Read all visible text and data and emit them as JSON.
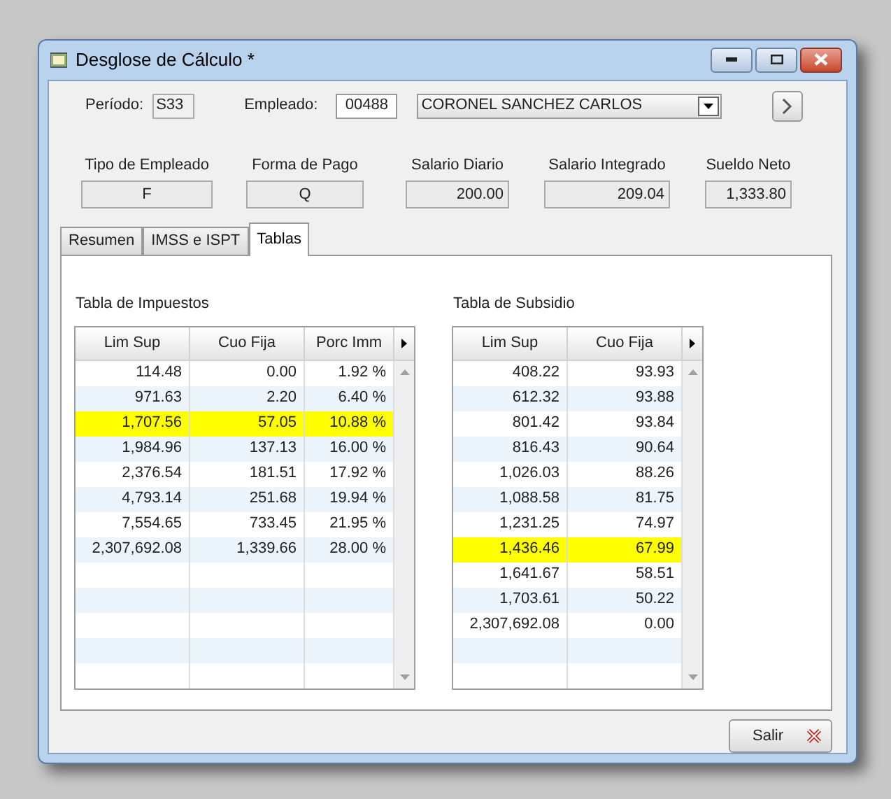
{
  "window": {
    "title": "Desglose de Cálculo *"
  },
  "header": {
    "periodo_label": "Período:",
    "periodo": "S33",
    "empleado_label": "Empleado:",
    "empleado": "00488",
    "nombre": "CORONEL SANCHEZ CARLOS"
  },
  "summary": [
    {
      "label": "Tipo de Empleado",
      "value": "F",
      "kind": "code"
    },
    {
      "label": "Forma de Pago",
      "value": "Q",
      "kind": "code"
    },
    {
      "label": "Salario Diario",
      "value": "200.00",
      "kind": "amount"
    },
    {
      "label": "Salario Integrado",
      "value": "209.04",
      "kind": "amount"
    },
    {
      "label": "Sueldo Neto",
      "value": "1,333.80",
      "kind": "amount"
    }
  ],
  "tabs": [
    {
      "label": "Resumen",
      "selected": false
    },
    {
      "label": "IMSS e ISPT",
      "selected": false
    },
    {
      "label": "Tablas",
      "selected": true
    }
  ],
  "tables": [
    {
      "title": "Tabla de Impuestos",
      "columns": [
        "Lim Sup",
        "Cuo Fija",
        "Porc Imm"
      ],
      "rows": [
        {
          "cells": [
            "114.48",
            "0.00",
            "1.92 %"
          ],
          "selected": false
        },
        {
          "cells": [
            "971.63",
            "2.20",
            "6.40 %"
          ],
          "selected": false
        },
        {
          "cells": [
            "1,707.56",
            "57.05",
            "10.88 %"
          ],
          "selected": true
        },
        {
          "cells": [
            "1,984.96",
            "137.13",
            "16.00 %"
          ],
          "selected": false
        },
        {
          "cells": [
            "2,376.54",
            "181.51",
            "17.92 %"
          ],
          "selected": false
        },
        {
          "cells": [
            "4,793.14",
            "251.68",
            "19.94 %"
          ],
          "selected": false
        },
        {
          "cells": [
            "7,554.65",
            "733.45",
            "21.95 %"
          ],
          "selected": false
        },
        {
          "cells": [
            "2,307,692.08",
            "1,339.66",
            "28.00 %"
          ],
          "selected": false
        }
      ]
    },
    {
      "title": "Tabla de Subsidio",
      "columns": [
        "Lim Sup",
        "Cuo Fija"
      ],
      "rows": [
        {
          "cells": [
            "408.22",
            "93.93"
          ],
          "selected": false
        },
        {
          "cells": [
            "612.32",
            "93.88"
          ],
          "selected": false
        },
        {
          "cells": [
            "801.42",
            "93.84"
          ],
          "selected": false
        },
        {
          "cells": [
            "816.43",
            "90.64"
          ],
          "selected": false
        },
        {
          "cells": [
            "1,026.03",
            "88.26"
          ],
          "selected": false
        },
        {
          "cells": [
            "1,088.58",
            "81.75"
          ],
          "selected": false
        },
        {
          "cells": [
            "1,231.25",
            "74.97"
          ],
          "selected": false
        },
        {
          "cells": [
            "1,436.46",
            "67.99"
          ],
          "selected": true
        },
        {
          "cells": [
            "1,641.67",
            "58.51"
          ],
          "selected": false
        },
        {
          "cells": [
            "1,703.61",
            "50.22"
          ],
          "selected": false
        },
        {
          "cells": [
            "2,307,692.08",
            "0.00"
          ],
          "selected": false
        }
      ]
    }
  ],
  "buttons": [
    {
      "label": "Salir"
    }
  ]
}
